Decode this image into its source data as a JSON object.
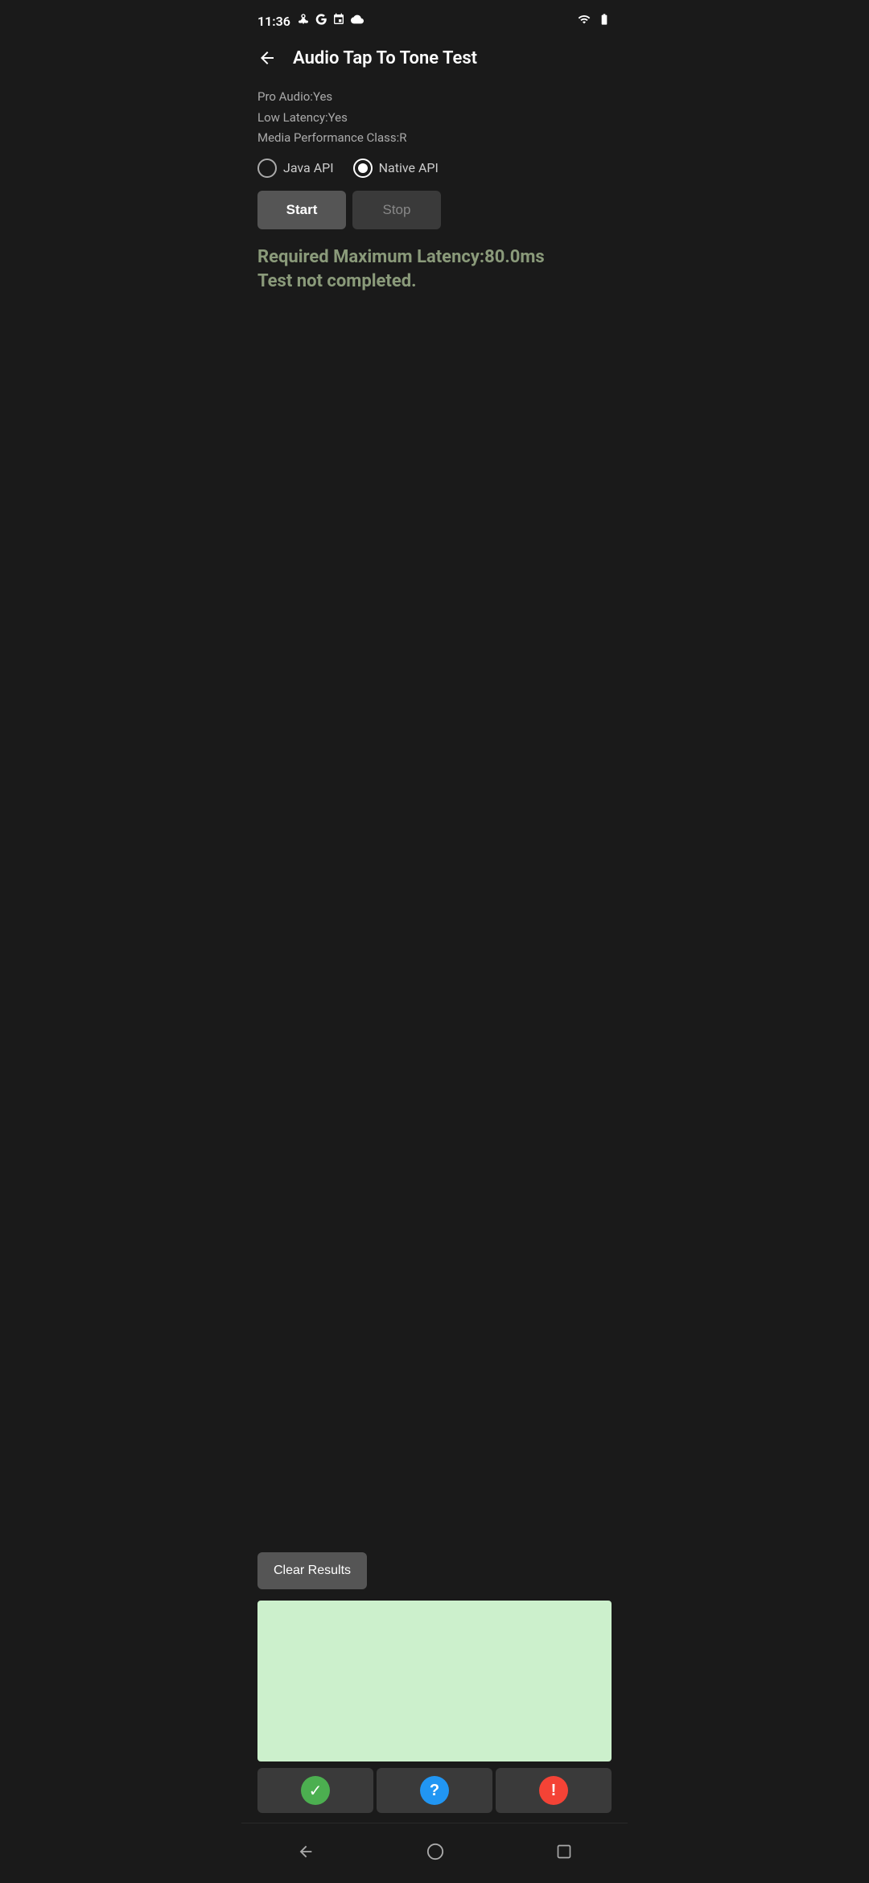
{
  "statusBar": {
    "time": "11:36",
    "icons": [
      "fan",
      "google",
      "calendar",
      "cloud"
    ]
  },
  "toolbar": {
    "title": "Audio Tap To Tone Test",
    "backLabel": "←"
  },
  "info": {
    "proAudio": "Pro Audio:Yes",
    "lowLatency": "Low Latency:Yes",
    "mediaPerformance": "Media Performance Class:R"
  },
  "radioGroup": {
    "options": [
      {
        "id": "java",
        "label": "Java API",
        "selected": false
      },
      {
        "id": "native",
        "label": "Native API",
        "selected": true
      }
    ]
  },
  "buttons": {
    "start": "Start",
    "stop": "Stop"
  },
  "statusText": {
    "line1": "Required Maximum Latency:80.0ms",
    "line2": "Test not completed."
  },
  "clearResults": "Clear Results",
  "bottomNav": {
    "back": "◀",
    "home": "○",
    "recents": "□"
  }
}
